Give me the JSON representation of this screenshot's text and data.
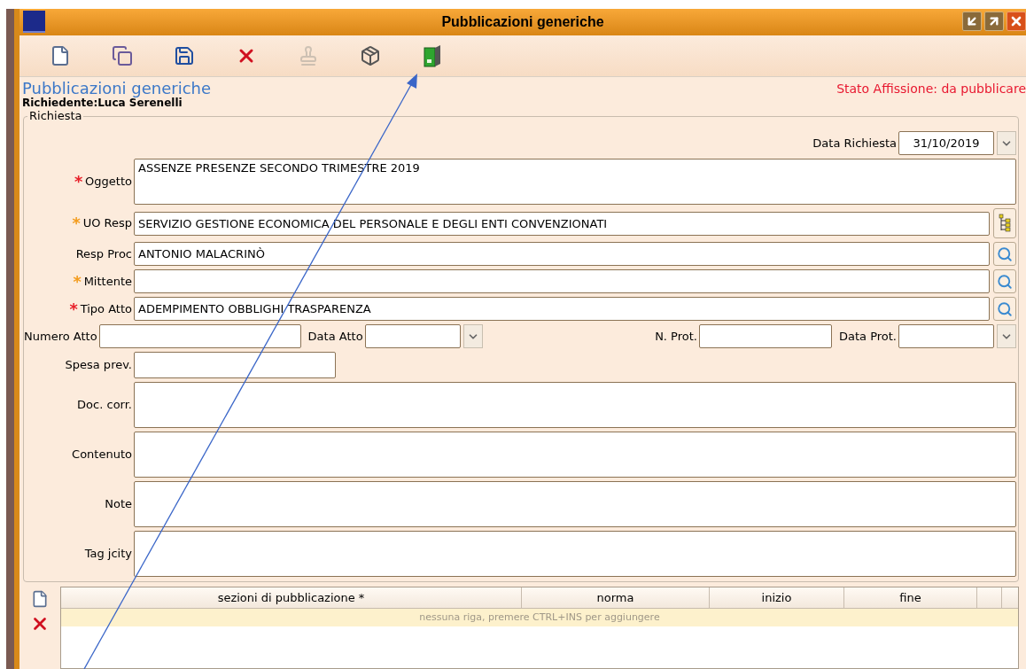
{
  "window": {
    "title": "Pubblicazioni generiche"
  },
  "toolbar": [
    {
      "kind": "new",
      "disabled": false
    },
    {
      "kind": "copy",
      "disabled": false
    },
    {
      "kind": "save",
      "disabled": false
    },
    {
      "kind": "delete",
      "disabled": false
    },
    {
      "kind": "stamp",
      "disabled": true
    },
    {
      "kind": "box",
      "disabled": false
    },
    {
      "kind": "binder",
      "disabled": false
    }
  ],
  "heading": "Pubblicazioni generiche",
  "status": "Stato Affissione: da pubblicare",
  "requester": "Richiedente:Luca Serenelli",
  "group": {
    "legend": "Richiesta",
    "date_field": {
      "label": "Data Richiesta",
      "value": "31/10/2019"
    },
    "rows": [
      {
        "kind": "area",
        "label": "Oggetto",
        "mark": "*",
        "color": "#e8202a",
        "value": "ASSENZE PRESENZE SECONDO TRIMESTRE 2019"
      },
      {
        "kind": "tree",
        "label": "UO Resp",
        "mark": "*",
        "color": "#f39c1e",
        "value": "SERVIZIO GESTIONE ECONOMICA DEL PERSONALE E DEGLI ENTI CONVENZIONATI"
      },
      {
        "kind": "search",
        "label": "Resp Proc",
        "value": "ANTONIO MALACRINÒ"
      },
      {
        "kind": "search",
        "label": "Mittente",
        "mark": "*",
        "color": "#f39c1e"
      },
      {
        "kind": "search",
        "label": "Tipo Atto",
        "mark": "*",
        "color": "#e8202a",
        "value": "ADEMPIMENTO OBBLIGHI TRASPARENZA"
      }
    ],
    "atto": [
      {
        "kind": "text",
        "label": "Numero Atto"
      },
      {
        "kind": "date",
        "label": "Data Atto"
      },
      {
        "kind": "text",
        "label": "N. Prot."
      },
      {
        "kind": "date",
        "label": "Data Prot."
      }
    ],
    "spesa": {
      "label": "Spesa prev."
    },
    "areas": [
      {
        "label": "Doc. corr."
      },
      {
        "label": "Contenuto"
      },
      {
        "label": "Note"
      },
      {
        "label": "Tag jcity"
      }
    ]
  },
  "table": {
    "columns": [
      "sezioni di pubblicazione *",
      "norma",
      "inizio",
      "fine"
    ],
    "empty_message": "nessuna riga, premere CTRL+INS per aggiungere"
  }
}
